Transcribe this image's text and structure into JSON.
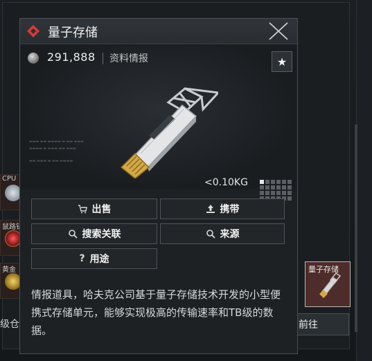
{
  "dialog": {
    "title": "量子存储",
    "price": "291,888",
    "category": "资料情报",
    "weight": "<0.10KG",
    "description": "情报道具，哈夫克公司基于量子存储技术开发的小型便携式存储单元，能够实现极高的传输速率和TB级的数据。"
  },
  "actions": {
    "sell": "出售",
    "carry": "携带",
    "search_related": "搜索关联",
    "source": "来源",
    "usage": "用途"
  },
  "background": {
    "left_labels": [
      "CPU",
      "鼠路钻",
      "黄金"
    ],
    "bottom_left_text": "级仓",
    "right_thumb_label": "量子存储",
    "goto_button": "前往"
  },
  "colors": {
    "accent": "#d9383b",
    "panel": "#1d2124",
    "thumb_bg": "#4e2c2a"
  },
  "icons": {
    "title": "red-diamond-icon",
    "close": "close-x-icon",
    "currency": "silver-coin-icon",
    "favorite": "star-icon",
    "sell": "sell-cart-icon",
    "carry": "upload-icon",
    "search": "magnifier-icon",
    "usage": "question-icon"
  }
}
